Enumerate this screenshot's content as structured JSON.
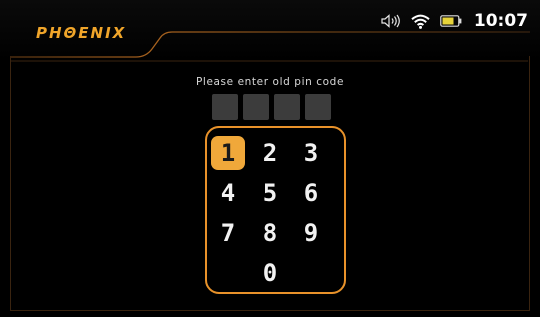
{
  "header": {
    "logo": "PHΘENIX",
    "time": "10:07",
    "icons": [
      "speaker-icon",
      "wifi-icon",
      "battery-icon"
    ]
  },
  "pin": {
    "prompt": "Please enter old pin code",
    "slots": 4,
    "entered": 0
  },
  "keypad": {
    "selected": "1",
    "keys": [
      "1",
      "2",
      "3",
      "4",
      "5",
      "6",
      "7",
      "8",
      "9",
      "0"
    ]
  },
  "colors": {
    "accent": "#f0a83a",
    "keypad_border": "#e8922a",
    "pin_box": "#3c3c3c"
  }
}
